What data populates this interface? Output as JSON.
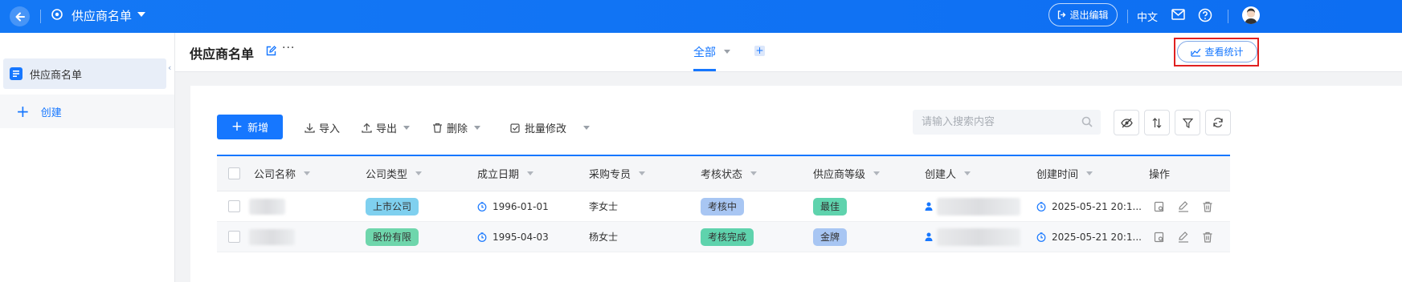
{
  "topbar": {
    "title": "供应商名单",
    "exit_edit": "退出编辑",
    "language": "中文"
  },
  "sidebar": {
    "items": [
      {
        "label": "供应商名单"
      }
    ],
    "create_label": "创建"
  },
  "header": {
    "page_title": "供应商名单",
    "more": "···",
    "tab_all": "全部",
    "stats_button": "查看统计"
  },
  "toolbar": {
    "new_label": "新增",
    "import_label": "导入",
    "export_label": "导出",
    "delete_label": "删除",
    "batch_edit_label": "批量修改",
    "search_placeholder": "请输入搜索内容"
  },
  "table": {
    "columns": [
      "公司名称",
      "公司类型",
      "成立日期",
      "采购专员",
      "考核状态",
      "供应商等级",
      "创建人",
      "创建时间",
      "操作"
    ],
    "rows": [
      {
        "company_type": "上市公司",
        "founded": "1996-01-01",
        "buyer": "李女士",
        "review_status": "考核中",
        "level": "最佳",
        "created_at": "2025-05-21 20:1..."
      },
      {
        "company_type": "股份有限",
        "founded": "1995-04-03",
        "buyer": "杨女士",
        "review_status": "考核完成",
        "level": "金牌",
        "created_at": "2025-05-21 20:1..."
      }
    ]
  },
  "colors": {
    "primary": "#1677ff",
    "topbar": "#1478f5",
    "tag_listed": "#7fd0ef",
    "tag_joint": "#6fd6ac",
    "tag_reviewing": "#a8c6f3",
    "tag_best": "#5fd3ad"
  }
}
